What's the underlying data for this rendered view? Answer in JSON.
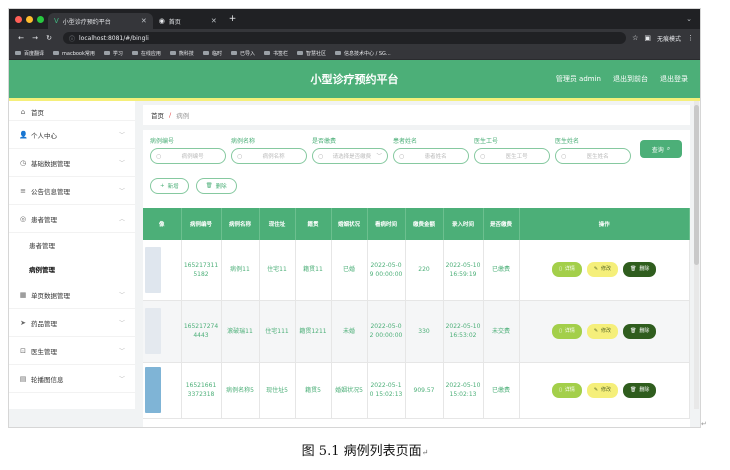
{
  "browser": {
    "tabs": [
      {
        "title": "小型诊疗预约平台",
        "active": true
      },
      {
        "title": "首页",
        "active": false
      }
    ],
    "url": "localhost:8081/#/bingli",
    "incognito": "无痕模式",
    "bookmarks": [
      "百度翻译",
      "macbook常用",
      "学习",
      "在线应用",
      "熊科技",
      "临时",
      "已导入",
      "书签栏",
      "智慧社区",
      "信息技术中心 / SG..."
    ]
  },
  "header": {
    "title": "小型诊疗预约平台",
    "links": [
      "管理员 admin",
      "退出到前台",
      "退出登录"
    ]
  },
  "sidebar": {
    "items": [
      {
        "label": "首页",
        "icon": "home-icon",
        "glyph": "⌂",
        "chev": false
      },
      {
        "label": "个人中心",
        "icon": "person-icon",
        "glyph": "👤",
        "chev": true
      },
      {
        "label": "基础数据管理",
        "icon": "clock-icon",
        "glyph": "◷",
        "chev": true
      },
      {
        "label": "公告信息管理",
        "icon": "list-icon",
        "glyph": "≡",
        "chev": true
      },
      {
        "label": "患者管理",
        "icon": "globe-icon",
        "glyph": "◎",
        "chev": true,
        "expanded": true,
        "sub": [
          {
            "label": "患者管理",
            "active": false
          },
          {
            "label": "病例管理",
            "active": true
          }
        ]
      },
      {
        "label": "单页数据管理",
        "icon": "database-icon",
        "glyph": "▦",
        "chev": true
      },
      {
        "label": "药品管理",
        "icon": "send-icon",
        "glyph": "➤",
        "chev": true
      },
      {
        "label": "医生管理",
        "icon": "crop-icon",
        "glyph": "⊡",
        "chev": true
      },
      {
        "label": "轮播图信息",
        "icon": "calendar-icon",
        "glyph": "▤",
        "chev": true
      }
    ]
  },
  "breadcrumb": {
    "home": "首页",
    "sep": "/",
    "current": "病例"
  },
  "filters": [
    {
      "label": "病例编号",
      "placeholder": "病例编号"
    },
    {
      "label": "病例名称",
      "placeholder": "病例名称"
    },
    {
      "label": "是否缴费",
      "placeholder": "请选择是否缴费"
    },
    {
      "label": "患者姓名",
      "placeholder": "患者姓名"
    },
    {
      "label": "医生工号",
      "placeholder": "医生工号"
    },
    {
      "label": "医生姓名",
      "placeholder": "医生姓名"
    }
  ],
  "query_label": "查询",
  "toolbar": {
    "add": "新增",
    "delete": "删除"
  },
  "table": {
    "headers": [
      "像",
      "病例编号",
      "病例名称",
      "现住址",
      "籍贯",
      "婚姻状况",
      "看病时间",
      "缴费金额",
      "录入时间",
      "是否缴费",
      "操作"
    ],
    "rows": [
      {
        "photo": "#dfe6ee",
        "cells": [
          "1652173115182",
          "病例11",
          "住宅11",
          "籍贯11",
          "已婚",
          "2022-05-09 00:00:00",
          "220",
          "2022-05-10 16:59:19",
          "已缴费"
        ]
      },
      {
        "photo": "#e4e9ef",
        "cells": [
          "1652172744443",
          "滚破瑞11",
          "住宅111",
          "籍贯1211",
          "未婚",
          "2022-05-02 00:00:00",
          "330",
          "2022-05-10 16:53:02",
          "未交费"
        ]
      },
      {
        "photo": "#7fb4d6",
        "cells": [
          "16521661 3372318",
          "病例名称5",
          "现住址5",
          "籍贯5",
          "婚姻状况5",
          "2022-05-10 15:02:13",
          "909.57",
          "2022-05-10 15:02:13",
          "已缴费"
        ]
      }
    ],
    "ops": [
      "详情",
      "修改",
      "删除"
    ]
  },
  "caption": "图 5.1 病例列表页面"
}
